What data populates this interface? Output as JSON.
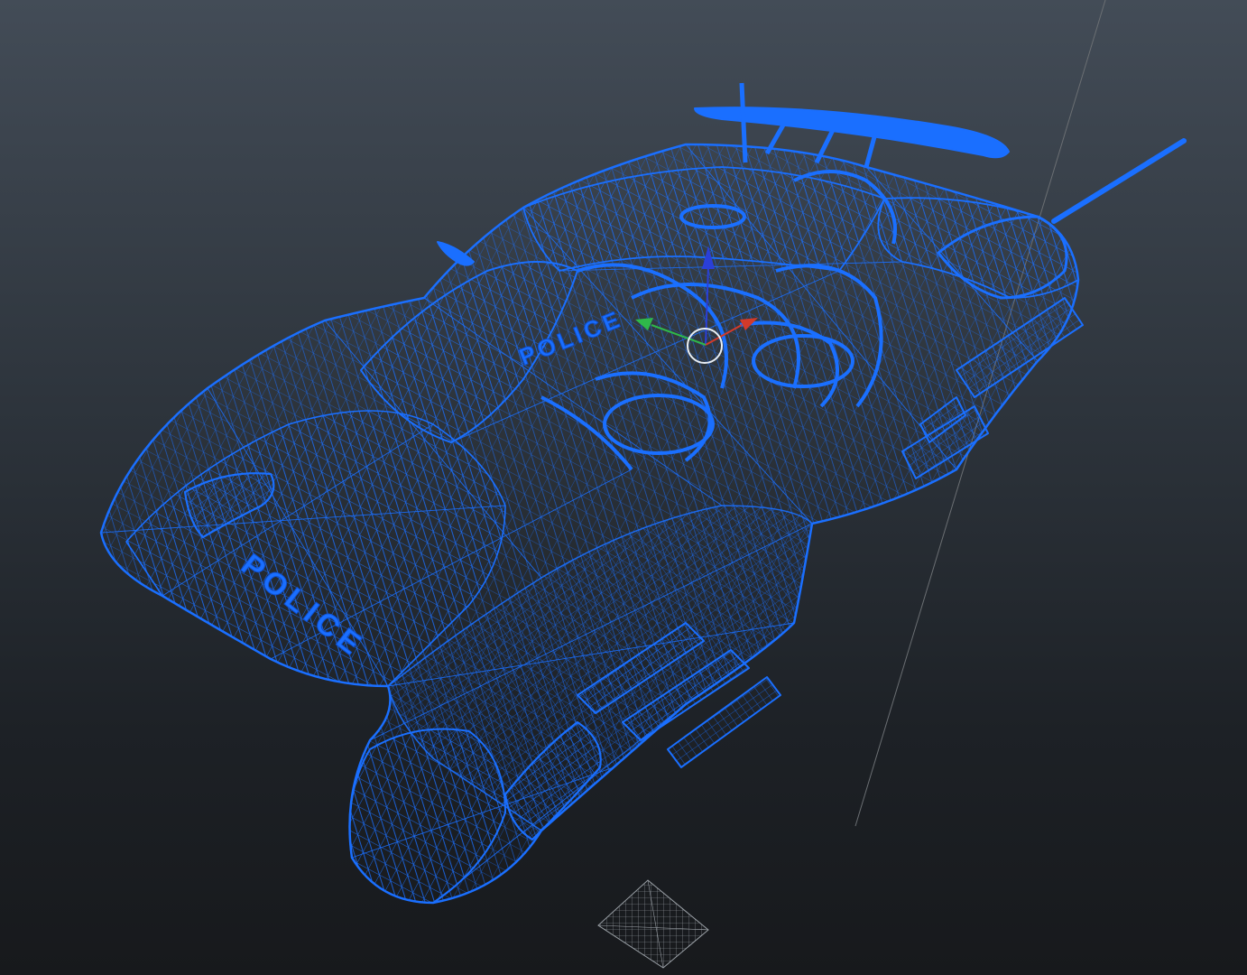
{
  "viewport": {
    "view": "perspective",
    "display_mode": "wireframe"
  },
  "model": {
    "decals": {
      "hood": "POLICE",
      "side": "POLICE"
    }
  },
  "colors": {
    "background_top": "#434c57",
    "background_bottom": "#17191c",
    "wireframe": "#1a6fff",
    "wireframe_dark": "#0e4fd0",
    "gizmo_up": "#2a3fd8",
    "gizmo_x": "#d23a2a",
    "gizmo_y": "#2fb84a",
    "pivot_ring": "#e8eef5",
    "ground_grid": "#9aa0a6",
    "world_axis": "#6b6f73"
  },
  "icons": {
    "transform_gizmo": "move-gizmo-icon",
    "pivot": "pivot-ring-icon",
    "ground_grid": "ground-grid-icon"
  }
}
